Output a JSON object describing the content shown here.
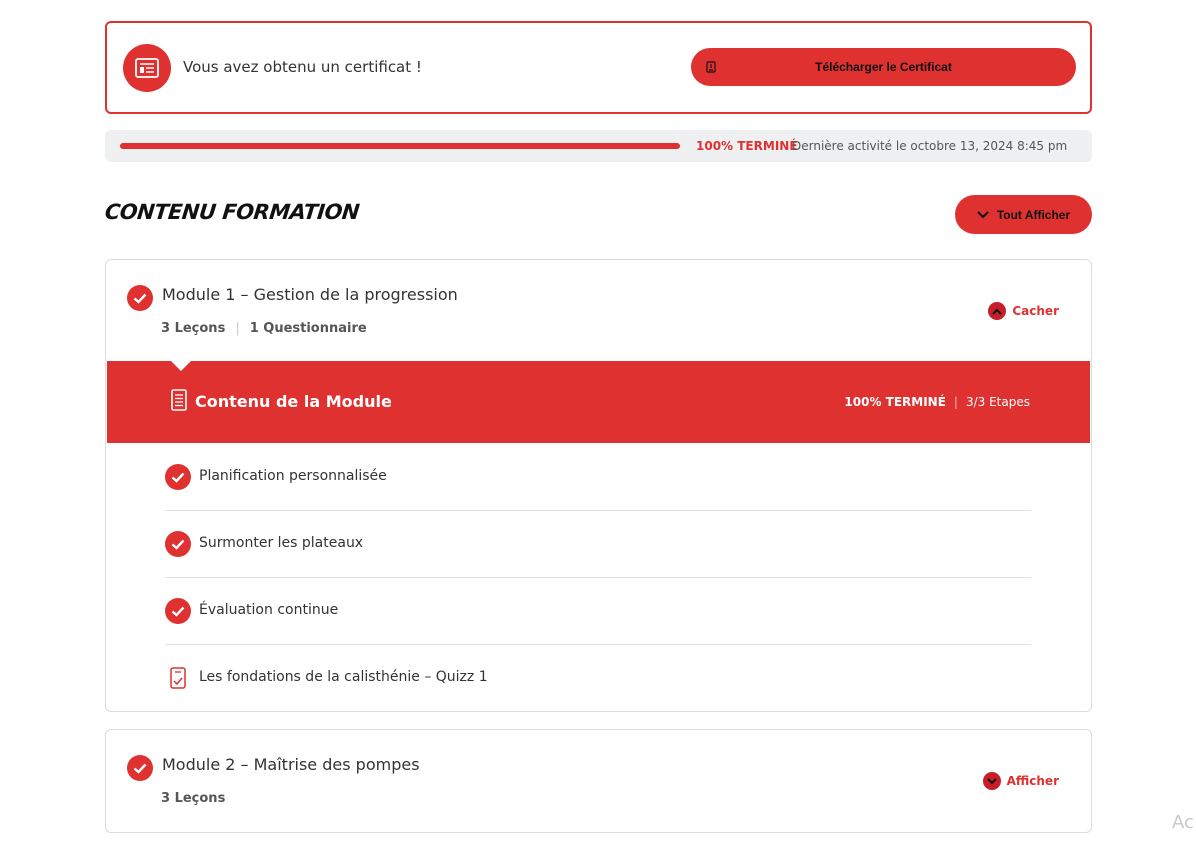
{
  "certificate": {
    "message": "Vous avez obtenu un certificat !",
    "download_label": "Télécharger le Certificat",
    "icon": "certificate-icon"
  },
  "progress": {
    "percent": 100,
    "status_label": "100% TERMINÉ",
    "last_activity": "Dernière activité le octobre 13, 2024 8:45 pm"
  },
  "section": {
    "title": "CONTENU FORMATION",
    "expand_all_label": "Tout Afficher"
  },
  "modules": [
    {
      "title": "Module 1 – Gestion de la progression",
      "lessons_count": "3 Leçons",
      "quiz_count": "1 Questionnaire",
      "toggle_label": "Cacher",
      "content": {
        "title": "Contenu de la Module",
        "status": "100% TERMINÉ",
        "steps": "3/3 Etapes"
      },
      "items": [
        {
          "label": "Planification personnalisée",
          "icon": "check-icon"
        },
        {
          "label": "Surmonter les plateaux",
          "icon": "check-icon"
        },
        {
          "label": "Évaluation continue",
          "icon": "check-icon"
        },
        {
          "label": "Les fondations de la calisthénie – Quizz 1",
          "icon": "quiz-icon"
        }
      ]
    },
    {
      "title": "Module 2 – Maîtrise des pompes",
      "lessons_count": "3 Leçons",
      "toggle_label": "Afficher"
    }
  ],
  "corner_text": "Ac",
  "colors": {
    "accent": "#e03131",
    "accent_dark": "#c71f2a",
    "panel": "#eef0f2"
  }
}
